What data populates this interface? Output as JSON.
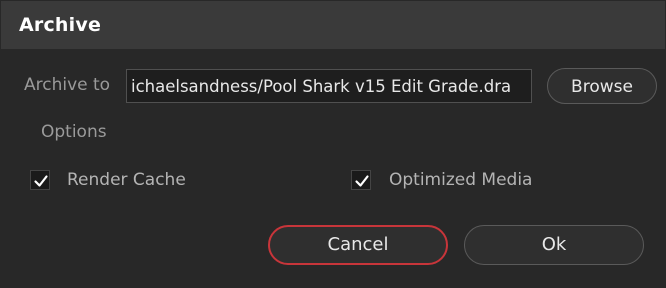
{
  "dialog": {
    "title": "Archive",
    "archive_to_label": "Archive to",
    "archive_path": "ichaelsandness/Pool Shark v15 Edit Grade.dra",
    "browse_label": "Browse",
    "options_label": "Options",
    "options": [
      {
        "label": "Render Cache",
        "checked": true,
        "icon": "checkmark-icon"
      },
      {
        "label": "Optimized Media",
        "checked": true,
        "icon": "checkmark-icon"
      }
    ],
    "cancel_label": "Cancel",
    "ok_label": "Ok"
  },
  "colors": {
    "background": "#282828",
    "title_bar": "#3a3a3a",
    "cancel_border": "#c8353a",
    "field_background": "#1e1e1e"
  }
}
